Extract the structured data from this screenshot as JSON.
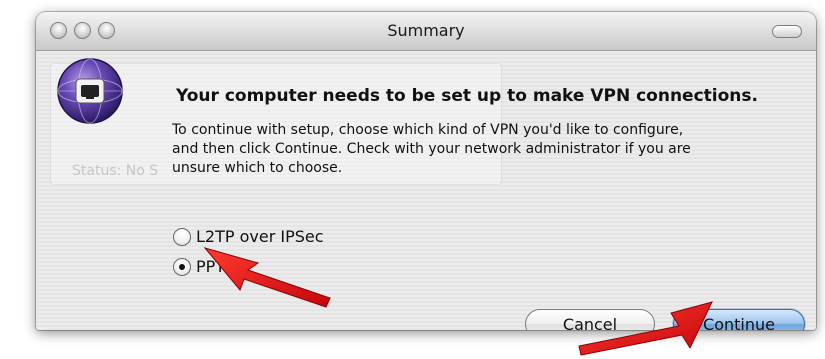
{
  "window": {
    "title": "Summary"
  },
  "background_ghost": {
    "text": "Status:  No S"
  },
  "dialog": {
    "heading": "Your computer needs to be set up to make VPN connections.",
    "body_line1": "To continue with setup, choose which kind of VPN you'd like to configure,",
    "body_line2": "and then click Continue. Check with your network administrator if you are",
    "body_line3": "unsure which to choose.",
    "options": [
      {
        "label": "L2TP over IPSec",
        "selected": false
      },
      {
        "label": "PPTP",
        "selected": true
      }
    ],
    "cancel_label": "Cancel",
    "continue_label": "Continue"
  },
  "icons": {
    "app_icon": "vpn-globe-icon",
    "annotation_arrows": [
      "red-arrow-icon",
      "red-arrow-icon"
    ]
  },
  "colors": {
    "arrow_red": "#e0141a",
    "default_button_blue": "#6fa4de",
    "icon_purple": "#4a2f8c"
  }
}
